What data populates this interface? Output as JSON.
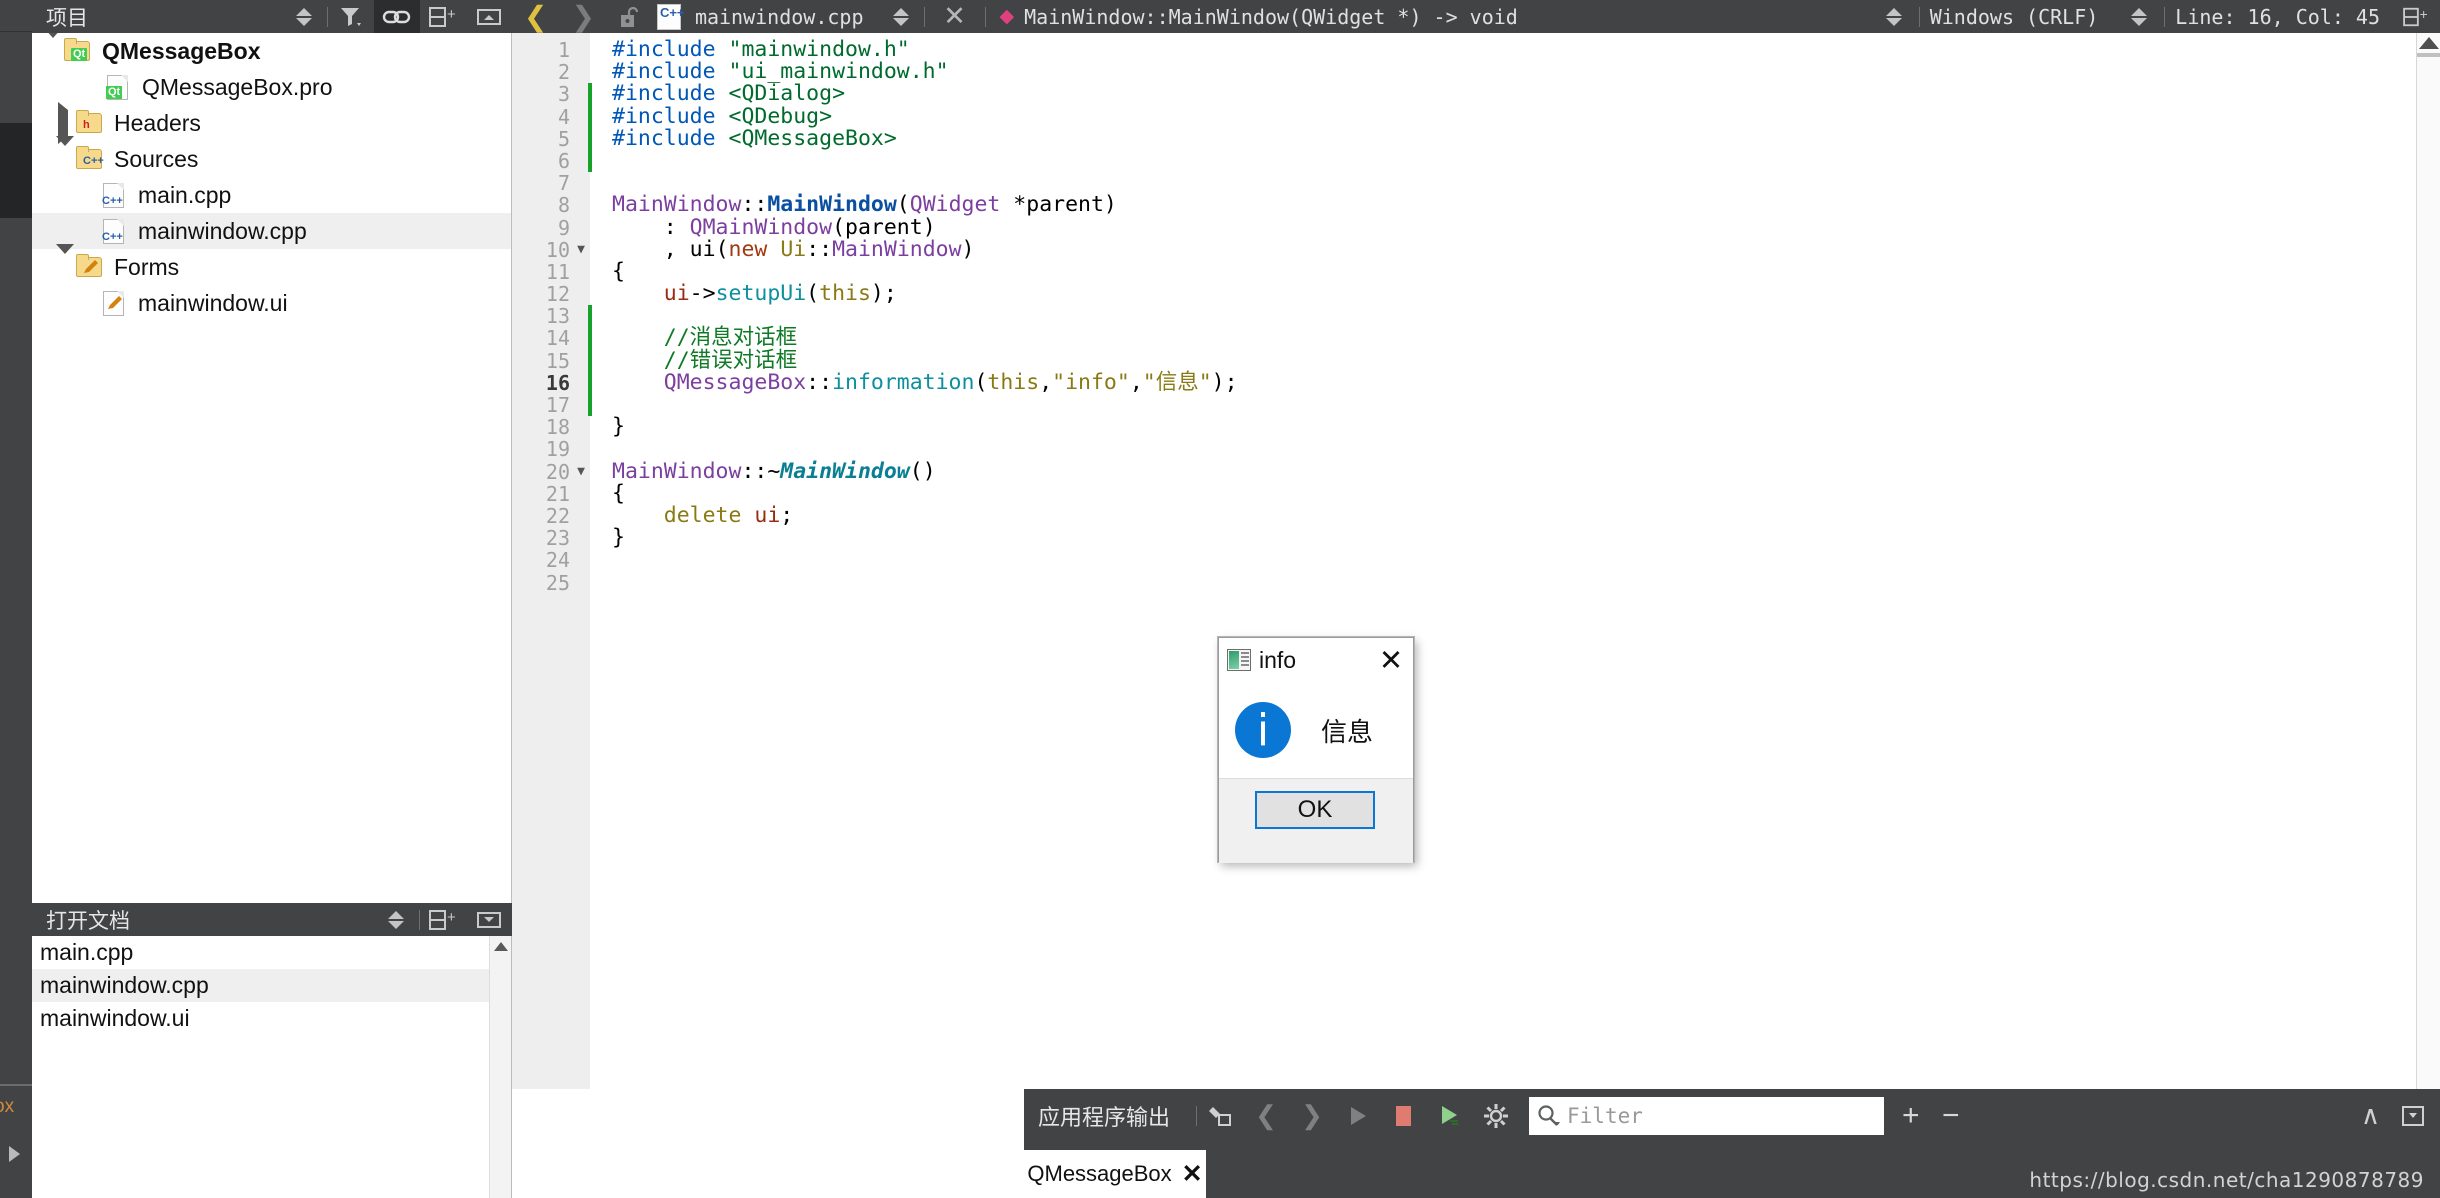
{
  "modebar": {
    "truncated_label": "ox"
  },
  "project_panel": {
    "title": "项目",
    "buttons": [
      "sync-selection",
      "filter",
      "link-with-editor",
      "split",
      "close-split"
    ],
    "tree": [
      {
        "label": "QMessageBox",
        "indent": 0,
        "expander": "down",
        "icon": "folder-qt",
        "bold": true,
        "selected": false
      },
      {
        "label": "QMessageBox.pro",
        "indent": 1,
        "expander": "none",
        "icon": "file-qt",
        "bold": false,
        "selected": false
      },
      {
        "label": "Headers",
        "indent": 0,
        "expander": "right",
        "icon": "folder-h",
        "bold": false,
        "selected": false
      },
      {
        "label": "Sources",
        "indent": 0,
        "expander": "down",
        "icon": "folder-cpp",
        "bold": false,
        "selected": false
      },
      {
        "label": "main.cpp",
        "indent": 1,
        "expander": "none",
        "icon": "file-cpp",
        "bold": false,
        "selected": false
      },
      {
        "label": "mainwindow.cpp",
        "indent": 1,
        "expander": "none",
        "icon": "file-cpp",
        "bold": false,
        "selected": true
      },
      {
        "label": "Forms",
        "indent": 0,
        "expander": "down",
        "icon": "folder-ui",
        "bold": false,
        "selected": false
      },
      {
        "label": "mainwindow.ui",
        "indent": 1,
        "expander": "none",
        "icon": "file-ui",
        "bold": false,
        "selected": false
      }
    ]
  },
  "open_documents": {
    "title": "打开文档",
    "buttons": [
      "sync-selection",
      "split",
      "close-split"
    ],
    "items": [
      {
        "label": "main.cpp",
        "selected": false
      },
      {
        "label": "mainwindow.cpp",
        "selected": true
      },
      {
        "label": "mainwindow.ui",
        "selected": false
      }
    ]
  },
  "editor_toolbar": {
    "back_icon": "chevron-left-icon",
    "forward_icon": "chevron-right-icon",
    "lock_icon": "unlock-icon",
    "file_icon": "cpp-file-icon",
    "filename": "mainwindow.cpp",
    "close_icon": "close-icon",
    "symbol_marker": "diamond-icon",
    "symbol": "MainWindow::MainWindow(QWidget *) -> void",
    "line_ending": "Windows (CRLF)",
    "cursor_position": "Line: 16, Col: 45",
    "split_icon": "split-icon",
    "close_split_icon": "close-split-icon"
  },
  "code": {
    "current_line": 16,
    "lines": [
      {
        "n": 1,
        "fold": "",
        "change": false,
        "tokens": [
          {
            "t": "#include",
            "c": "k-pre"
          },
          {
            "t": " ",
            "c": "k-pun"
          },
          {
            "t": "\"mainwindow.h\"",
            "c": "k-str"
          }
        ]
      },
      {
        "n": 2,
        "fold": "",
        "change": false,
        "tokens": [
          {
            "t": "#include",
            "c": "k-pre"
          },
          {
            "t": " ",
            "c": "k-pun"
          },
          {
            "t": "\"ui_mainwindow.h\"",
            "c": "k-str"
          }
        ]
      },
      {
        "n": 3,
        "fold": "",
        "change": true,
        "tokens": [
          {
            "t": "#include",
            "c": "k-pre"
          },
          {
            "t": " ",
            "c": "k-pun"
          },
          {
            "t": "<QDialog>",
            "c": "k-str"
          }
        ]
      },
      {
        "n": 4,
        "fold": "",
        "change": true,
        "tokens": [
          {
            "t": "#include",
            "c": "k-pre"
          },
          {
            "t": " ",
            "c": "k-pun"
          },
          {
            "t": "<QDebug>",
            "c": "k-str"
          }
        ]
      },
      {
        "n": 5,
        "fold": "",
        "change": true,
        "tokens": [
          {
            "t": "#include",
            "c": "k-pre"
          },
          {
            "t": " ",
            "c": "k-pun"
          },
          {
            "t": "<QMessageBox>",
            "c": "k-str"
          }
        ]
      },
      {
        "n": 6,
        "fold": "",
        "change": true,
        "tokens": []
      },
      {
        "n": 7,
        "fold": "",
        "change": false,
        "tokens": []
      },
      {
        "n": 8,
        "fold": "",
        "change": false,
        "tokens": [
          {
            "t": "MainWindow",
            "c": "k-cls"
          },
          {
            "t": "::",
            "c": "k-pun"
          },
          {
            "t": "MainWindow",
            "c": "k-fnb"
          },
          {
            "t": "(",
            "c": "k-pun"
          },
          {
            "t": "QWidget",
            "c": "k-cls"
          },
          {
            "t": " *",
            "c": "k-pun"
          },
          {
            "t": "parent",
            "c": "k-pun"
          },
          {
            "t": ")",
            "c": "k-pun"
          }
        ]
      },
      {
        "n": 9,
        "fold": "",
        "change": false,
        "tokens": [
          {
            "t": "    : ",
            "c": "k-pun"
          },
          {
            "t": "QMainWindow",
            "c": "k-cls"
          },
          {
            "t": "(",
            "c": "k-pun"
          },
          {
            "t": "parent",
            "c": "k-pun"
          },
          {
            "t": ")",
            "c": "k-pun"
          }
        ]
      },
      {
        "n": 10,
        "fold": "▼",
        "change": false,
        "tokens": [
          {
            "t": "    , ",
            "c": "k-pun"
          },
          {
            "t": "ui",
            "c": "k-pun"
          },
          {
            "t": "(",
            "c": "k-pun"
          },
          {
            "t": "new",
            "c": "k-new"
          },
          {
            "t": " ",
            "c": "k-pun"
          },
          {
            "t": "Ui",
            "c": "k-var"
          },
          {
            "t": "::",
            "c": "k-pun"
          },
          {
            "t": "MainWindow",
            "c": "k-cls"
          },
          {
            "t": ")",
            "c": "k-pun"
          }
        ]
      },
      {
        "n": 11,
        "fold": "",
        "change": false,
        "tokens": [
          {
            "t": "{",
            "c": "k-pun"
          }
        ]
      },
      {
        "n": 12,
        "fold": "",
        "change": false,
        "tokens": [
          {
            "t": "    ",
            "c": "k-pun"
          },
          {
            "t": "ui",
            "c": "k-red"
          },
          {
            "t": "->",
            "c": "k-pun"
          },
          {
            "t": "setupUi",
            "c": "k-fn"
          },
          {
            "t": "(",
            "c": "k-pun"
          },
          {
            "t": "this",
            "c": "k-var"
          },
          {
            "t": ");",
            "c": "k-pun"
          }
        ]
      },
      {
        "n": 13,
        "fold": "",
        "change": true,
        "tokens": []
      },
      {
        "n": 14,
        "fold": "",
        "change": true,
        "tokens": [
          {
            "t": "    //消息对话框",
            "c": "k-cmt"
          }
        ]
      },
      {
        "n": 15,
        "fold": "",
        "change": true,
        "tokens": [
          {
            "t": "    //错误对话框",
            "c": "k-cmt"
          }
        ]
      },
      {
        "n": 16,
        "fold": "",
        "change": true,
        "tokens": [
          {
            "t": "    ",
            "c": "k-pun"
          },
          {
            "t": "QMessageBox",
            "c": "k-cls"
          },
          {
            "t": "::",
            "c": "k-pun"
          },
          {
            "t": "information",
            "c": "k-fn"
          },
          {
            "t": "(",
            "c": "k-pun"
          },
          {
            "t": "this",
            "c": "k-var"
          },
          {
            "t": ",",
            "c": "k-pun"
          },
          {
            "t": "\"info\"",
            "c": "k-str2"
          },
          {
            "t": ",",
            "c": "k-pun"
          },
          {
            "t": "\"信息\"",
            "c": "k-str2"
          },
          {
            "t": ");",
            "c": "k-pun"
          }
        ]
      },
      {
        "n": 17,
        "fold": "",
        "change": true,
        "tokens": []
      },
      {
        "n": 18,
        "fold": "",
        "change": false,
        "tokens": [
          {
            "t": "}",
            "c": "k-pun"
          }
        ]
      },
      {
        "n": 19,
        "fold": "",
        "change": false,
        "tokens": []
      },
      {
        "n": 20,
        "fold": "▼",
        "change": false,
        "tokens": [
          {
            "t": "MainWindow",
            "c": "k-cls"
          },
          {
            "t": "::~",
            "c": "k-pun"
          },
          {
            "t": "MainWindow",
            "c": "k-dtor"
          },
          {
            "t": "()",
            "c": "k-pun"
          }
        ]
      },
      {
        "n": 21,
        "fold": "",
        "change": false,
        "tokens": [
          {
            "t": "{",
            "c": "k-pun"
          }
        ]
      },
      {
        "n": 22,
        "fold": "",
        "change": false,
        "tokens": [
          {
            "t": "    ",
            "c": "k-pun"
          },
          {
            "t": "delete",
            "c": "k-var"
          },
          {
            "t": " ",
            "c": "k-pun"
          },
          {
            "t": "ui",
            "c": "k-red"
          },
          {
            "t": ";",
            "c": "k-pun"
          }
        ]
      },
      {
        "n": 23,
        "fold": "",
        "change": false,
        "tokens": [
          {
            "t": "}",
            "c": "k-pun"
          }
        ]
      },
      {
        "n": 24,
        "fold": "",
        "change": false,
        "tokens": []
      },
      {
        "n": 25,
        "fold": "",
        "change": false,
        "tokens": []
      }
    ]
  },
  "output_pane": {
    "title": "应用程序输出",
    "icons": [
      "clear-output-icon",
      "prev-item-icon",
      "next-item-icon",
      "run-icon",
      "stop-icon",
      "run-debug-icon",
      "settings-icon"
    ],
    "filter_placeholder": "Filter",
    "add_label": "+",
    "remove_label": "−",
    "maximize_icon": "chevron-up-icon",
    "menu_icon": "dropdown-icon",
    "tabs": [
      {
        "label": "QMessageBox",
        "close_icon": "close-icon",
        "active": true
      }
    ]
  },
  "message_box": {
    "window_icon": "app-window-icon",
    "title": "info",
    "close_label": "✕",
    "severity_icon": "info-icon",
    "severity_glyph": "i",
    "text": "信息",
    "buttons": [
      {
        "label": "OK",
        "default": true
      }
    ]
  },
  "watermark": {
    "text": "https://blog.csdn.net/cha1290878789"
  },
  "colors": {
    "chrome": "#414345",
    "accent_blue": "#0a77d5",
    "change_green": "#17a22b",
    "selection_gray": "#efefef"
  }
}
